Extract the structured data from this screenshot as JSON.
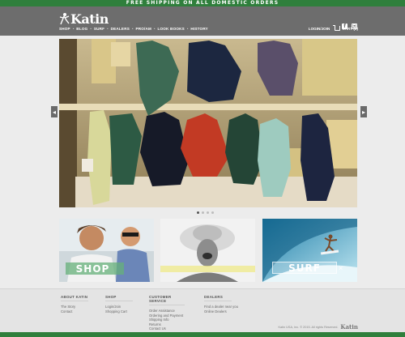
{
  "promo": {
    "text": "FREE SHIPPING ON ALL DOMESTIC ORDERS"
  },
  "header": {
    "brand": "Katin",
    "nav": [
      "SHOP",
      "BLOG",
      "SURF",
      "DEALERS",
      "PRO/AM",
      "LOOK BOOKS",
      "HISTORY"
    ],
    "login_label": "LOGIN/JOIN",
    "cart_label": "CART (0)",
    "social": [
      "facebook-icon",
      "instagram-icon"
    ]
  },
  "carousel": {
    "slides": 4,
    "active": 0
  },
  "tiles": [
    {
      "name": "shop",
      "label": "SHOP"
    },
    {
      "name": "portrait",
      "label": ""
    },
    {
      "name": "surf",
      "label": "SURF"
    }
  ],
  "footer": {
    "columns": [
      {
        "title": "ABOUT KATIN",
        "links": [
          "The Story",
          "Contact"
        ]
      },
      {
        "title": "SHOP",
        "links": [
          "Login/Join",
          "Shopping Cart"
        ]
      },
      {
        "title": "CUSTOMER SERVICE",
        "links": [
          "Order Assistance",
          "Ordering and Payment",
          "Shipping Info",
          "Returns",
          "Contact Us"
        ]
      },
      {
        "title": "DEALERS",
        "links": [
          "Find a dealer near you",
          "Online Dealers"
        ]
      }
    ],
    "copyright": "Katin USA, Inc. © 2015. All rights Reserved.",
    "footer_logo": "Katin"
  },
  "colors": {
    "promo": "#2f7f3c",
    "header": "#6d6d6d",
    "page": "#ececec"
  }
}
